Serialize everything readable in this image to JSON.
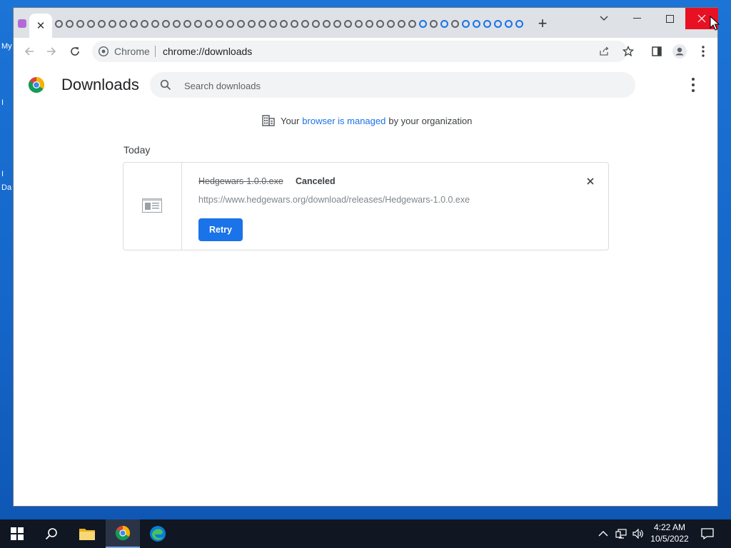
{
  "desktop": {
    "labels": [
      "My",
      "I",
      "I",
      "Da"
    ]
  },
  "browser": {
    "omnibox": {
      "site_label": "Chrome",
      "url": "chrome://downloads"
    }
  },
  "page": {
    "title": "Downloads",
    "search_placeholder": "Search downloads",
    "managed_notice": {
      "prefix": "Your",
      "link": "browser is managed",
      "suffix": "by your organization"
    },
    "date_header": "Today",
    "downloads": [
      {
        "file_name": "Hedgewars-1.0.0.exe",
        "status": "Canceled",
        "url": "https://www.hedgewars.org/download/releases/Hedgewars-1.0.0.exe",
        "action_label": "Retry"
      }
    ]
  },
  "taskbar": {
    "items": [
      "start-icon",
      "search-icon",
      "file-explorer-icon",
      "chrome-icon",
      "edge-icon"
    ],
    "clock": {
      "time": "4:22 AM",
      "date": "10/5/2022"
    }
  },
  "colors": {
    "accent": "#1a73e8",
    "close_red": "#e81123",
    "taskbar": "#101622",
    "desktop": "#1566c9"
  }
}
